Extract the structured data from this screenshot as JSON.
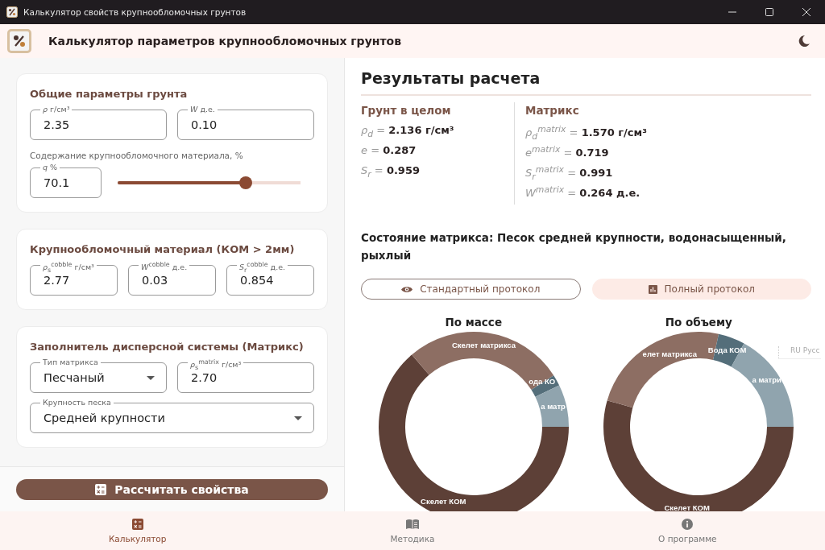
{
  "window": {
    "title": "Калькулятор свойств крупнообломочных грунтов"
  },
  "header": {
    "title": "Калькулятор параметров крупнообломочных грунтов"
  },
  "input_cards": [
    {
      "title": "Общие параметры грунта",
      "rows": [
        {
          "kind": "fields",
          "fields": [
            {
              "kind": "text",
              "label": "*ρ* г/см³",
              "value": "2.35"
            },
            {
              "kind": "text",
              "label": "*W* д.е.",
              "value": "0.10"
            }
          ]
        },
        {
          "kind": "caption",
          "text": "Содержание крупнообломочного материала, %"
        },
        {
          "kind": "slider",
          "field": {
            "kind": "text",
            "label": "*q* %",
            "value": "70.1"
          },
          "level": 0.701
        }
      ]
    },
    {
      "title": "Крупнообломочный материал (КОМ > 2мм)",
      "rows": [
        {
          "kind": "fields",
          "fields": [
            {
              "kind": "text",
              "label": "*ρ*$_{s}$$^{cobble}$ г/см³",
              "value": "2.77"
            },
            {
              "kind": "text",
              "label": "*W*$^{cobble}$ д.е.",
              "value": "0.03"
            },
            {
              "kind": "text",
              "label": "*S*$_{r}$$^{cobble}$ д.е.",
              "value": "0.854"
            }
          ]
        }
      ]
    },
    {
      "title": "Заполнитель дисперсной системы (Матрикс)",
      "rows": [
        {
          "kind": "fields",
          "fields": [
            {
              "kind": "select",
              "label": "Тип матрикса",
              "value": "Песчаный"
            },
            {
              "kind": "text",
              "label": "*ρ*$_{s}$$^{matrix}$ г/см³",
              "value": "2.70"
            }
          ]
        },
        {
          "kind": "fields",
          "fields": [
            {
              "kind": "select",
              "label": "Крупность песка",
              "value": "Средней крупности"
            }
          ]
        }
      ]
    }
  ],
  "calculate_button": {
    "label": "Рассчитать свойства"
  },
  "results": {
    "title": "Результаты расчета",
    "columns": [
      {
        "title": "Грунт в целом",
        "lines": [
          {
            "symbol": "ρ$_{d}$ =",
            "value": "2.136 г/см³"
          },
          {
            "symbol": "e =",
            "value": "0.287"
          },
          {
            "symbol": "S$_{r}$ =",
            "value": "0.959"
          }
        ]
      },
      {
        "title": "Матрикс",
        "lines": [
          {
            "symbol": "ρ$_{d}$$^{matrix}$ =",
            "value": "1.570 г/см³"
          },
          {
            "symbol": "e$^{matrix}$ =",
            "value": "0.719"
          },
          {
            "symbol": "S$_{r}$$^{matrix}$ =",
            "value": "0.991"
          },
          {
            "symbol": "W$^{matrix}$ =",
            "value": "0.264 д.е."
          }
        ]
      }
    ],
    "status": "Состояние матрикса: Песок средней крупности, водонасыщенный, рыхлый",
    "buttons": [
      {
        "kind": "outlined",
        "label": "Стандартный протокол"
      },
      {
        "kind": "tonal",
        "label": "Полный протокол"
      }
    ],
    "charts": [
      {
        "chart_data": {
          "type": "donut",
          "title": "По массе",
          "categories": [
            "Скелет КОМ",
            "Скелет матрикса",
            "ода КО",
            "а матр"
          ],
          "colors": [
            "#5d4037",
            "#8d6e63",
            "#546e7a",
            "#90a4ae"
          ],
          "series": [
            {
              "values": [
                0.637,
                0.272,
                0.019,
                0.072
              ]
            }
          ]
        }
      },
      {
        "chart_data": {
          "type": "donut",
          "title": "По объему",
          "categories": [
            "Скелет КОМ",
            "елет матрикса",
            "Вода КОМ",
            "а матри"
          ],
          "colors": [
            "#5d4037",
            "#8d6e63",
            "#546e7a",
            "#90a4ae"
          ],
          "series": [
            {
              "values": [
                0.54,
                0.237,
                0.045,
                0.169
              ]
            }
          ]
        }
      }
    ]
  },
  "language_indicator": "RU Русс",
  "nav": [
    {
      "label": "Калькулятор",
      "selected": true
    },
    {
      "label": "Методика",
      "selected": false
    },
    {
      "label": "О программе",
      "selected": false
    }
  ]
}
